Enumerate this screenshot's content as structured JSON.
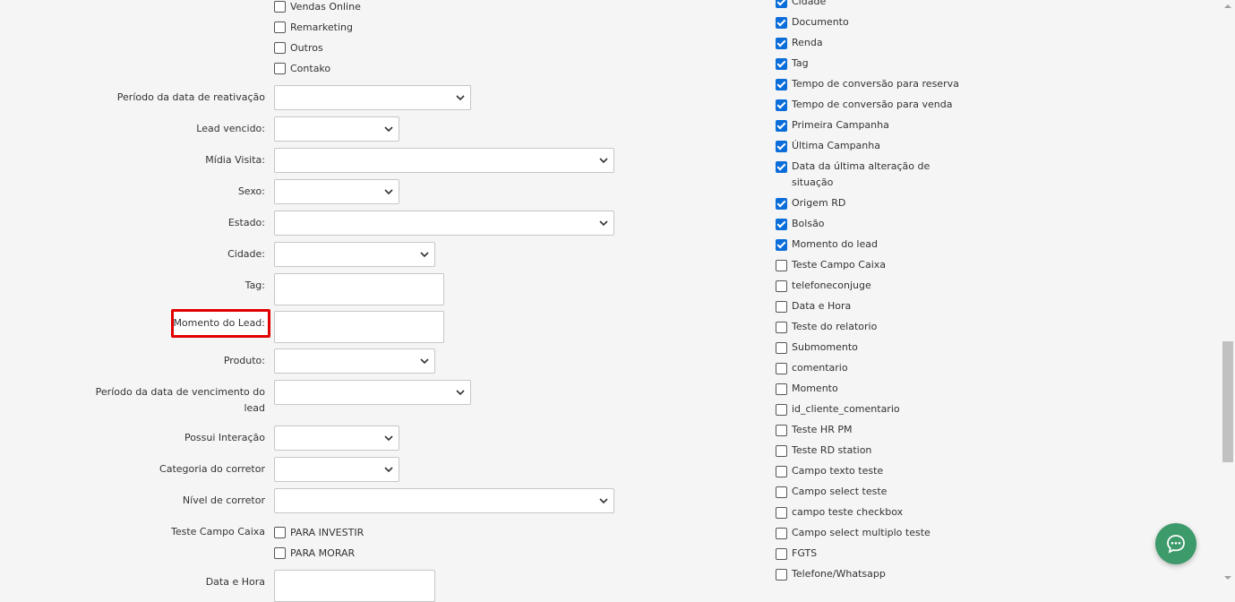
{
  "left_checkboxes_top": [
    {
      "label": "Vendas Online",
      "checked": false
    },
    {
      "label": "Remarketing",
      "checked": false
    },
    {
      "label": "Outros",
      "checked": false
    },
    {
      "label": "Contako",
      "checked": false
    }
  ],
  "fields": {
    "periodo_reativacao": "Período da data de reativação",
    "lead_vencido": "Lead vencido:",
    "midia_visita": "Mídia Visita:",
    "sexo": "Sexo:",
    "estado": "Estado:",
    "cidade": "Cidade:",
    "tag": "Tag:",
    "momento_lead": "Momento do Lead:",
    "produto": "Produto:",
    "periodo_vencimento_line1": "Período da data de vencimento do",
    "periodo_vencimento_line2": "lead",
    "possui_interacao": "Possui Interação",
    "categoria_corretor": "Categoria do corretor",
    "nivel_corretor": "Nível de corretor",
    "teste_campo_caixa": "Teste Campo Caixa",
    "data_hora": "Data e Hora"
  },
  "teste_campo_caixa_options": [
    {
      "label": "PARA INVESTIR",
      "checked": false
    },
    {
      "label": "PARA MORAR",
      "checked": false
    }
  ],
  "right_checkboxes": [
    {
      "label": "Cidade",
      "checked": true
    },
    {
      "label": "Documento",
      "checked": true
    },
    {
      "label": "Renda",
      "checked": true
    },
    {
      "label": "Tag",
      "checked": true
    },
    {
      "label": "Tempo de conversão para reserva",
      "checked": true
    },
    {
      "label": "Tempo de conversão para venda",
      "checked": true
    },
    {
      "label": "Primeira Campanha",
      "checked": true
    },
    {
      "label": "Última Campanha",
      "checked": true
    },
    {
      "label": "Data da última alteração de",
      "label2": "situação",
      "checked": true
    },
    {
      "label": "Origem RD",
      "checked": true
    },
    {
      "label": "Bolsão",
      "checked": true
    },
    {
      "label": "Momento do lead",
      "checked": true
    },
    {
      "label": "Teste Campo Caixa",
      "checked": false
    },
    {
      "label": "telefoneconjuge",
      "checked": false
    },
    {
      "label": "Data e Hora",
      "checked": false
    },
    {
      "label": "Teste do relatorio",
      "checked": false
    },
    {
      "label": "Submomento",
      "checked": false
    },
    {
      "label": "comentario",
      "checked": false
    },
    {
      "label": "Momento",
      "checked": false
    },
    {
      "label": "id_cliente_comentario",
      "checked": false
    },
    {
      "label": "Teste HR PM",
      "checked": false
    },
    {
      "label": "Teste RD station",
      "checked": false
    },
    {
      "label": "Campo texto teste",
      "checked": false
    },
    {
      "label": "Campo select teste",
      "checked": false
    },
    {
      "label": "campo teste checkbox",
      "checked": false
    },
    {
      "label": "Campo select multiplo teste",
      "checked": false
    },
    {
      "label": "FGTS",
      "checked": false
    },
    {
      "label": "Telefone/Whatsapp",
      "checked": false
    }
  ],
  "icons": {
    "select_arrow": "chevron-down-icon",
    "chat": "chat-bubble-icon"
  },
  "colors": {
    "checkbox_checked": "#0a6dd9",
    "highlight_border": "#e00000",
    "chat_button": "#3d9a6a"
  }
}
